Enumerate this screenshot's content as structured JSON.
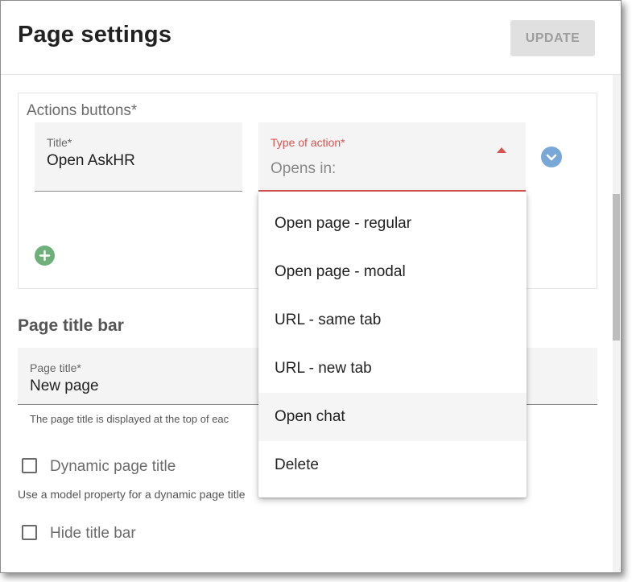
{
  "dialog": {
    "title": "Page settings",
    "update_label": "UPDATE"
  },
  "actions": {
    "section_label": "Actions buttons*",
    "title_field": {
      "label": "Title*",
      "value": "Open AskHR"
    },
    "type_field": {
      "label": "Type of action*",
      "placeholder": "Opens in:"
    },
    "expand_icon": "chevron-down-icon",
    "add_icon": "plus-icon"
  },
  "dropdown": {
    "options": [
      "Open page - regular",
      "Open page - modal",
      "URL - same tab",
      "URL - new tab",
      "Open chat",
      "Delete"
    ],
    "highlighted": "Open chat"
  },
  "page_title_bar": {
    "heading": "Page title bar",
    "page_title_field": {
      "label": "Page title*",
      "value": "New page"
    },
    "helper": "The page title is displayed at the top of eac",
    "dynamic_checkbox": {
      "label": "Dynamic page title",
      "checked": false
    },
    "dynamic_helper": "Use a model property for a dynamic page title",
    "hide_checkbox": {
      "label": "Hide title bar",
      "checked": false
    }
  },
  "colors": {
    "error_red": "#d9534f",
    "expand_blue": "#79a8d8",
    "add_green": "#6fb07a"
  }
}
